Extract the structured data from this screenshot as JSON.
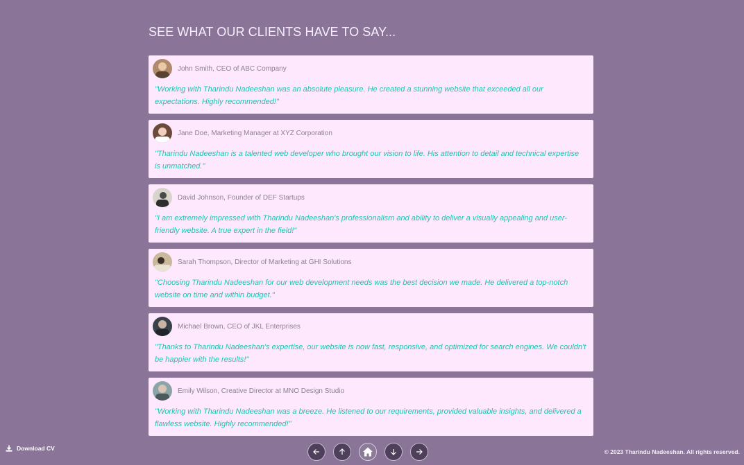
{
  "section": {
    "title": "SEE WHAT OUR CLIENTS HAVE TO SAY..."
  },
  "testimonials": [
    {
      "author": "John Smith, CEO of ABC Company",
      "quote": "\"Working with Tharindu Nadeeshan was an absolute pleasure. He created a stunning website that exceeded all our expectations. Highly recommended!\""
    },
    {
      "author": "Jane Doe, Marketing Manager at XYZ Corporation",
      "quote": "\"Tharindu Nadeeshan is a talented web developer who brought our vision to life. His attention to detail and technical expertise is unmatched.\""
    },
    {
      "author": "David Johnson, Founder of DEF Startups",
      "quote": "\"I am extremely impressed with Tharindu Nadeeshan's professionalism and ability to deliver a visually appealing and user-friendly website. A true expert in the field!\""
    },
    {
      "author": "Sarah Thompson, Director of Marketing at GHI Solutions",
      "quote": "\"Choosing Tharindu Nadeeshan for our web development needs was the best decision we made. He delivered a top-notch website on time and within budget.\""
    },
    {
      "author": "Michael Brown, CEO of JKL Enterprises",
      "quote": "\"Thanks to Tharindu Nadeeshan's expertise, our website is now fast, responsive, and optimized for search engines. We couldn't be happier with the results!\""
    },
    {
      "author": "Emily Wilson, Creative Director at MNO Design Studio",
      "quote": "\"Working with Tharindu Nadeeshan was a breeze. He listened to our requirements, provided valuable insights, and delivered a flawless website. Highly recommended!\""
    }
  ],
  "footer": {
    "download_label": "Download CV",
    "copyright": "© 2023 Tharindu Nadeeshan. All rights reserved."
  },
  "nav": {
    "buttons": [
      "arrow-left-icon",
      "arrow-up-icon",
      "home-icon",
      "arrow-down-icon",
      "arrow-right-icon"
    ]
  },
  "colors": {
    "background": "#8a7599",
    "card": "#fde8fd",
    "quote": "#1ec3b0",
    "author": "#8d8190",
    "nav_button": "#4e3f5a"
  }
}
